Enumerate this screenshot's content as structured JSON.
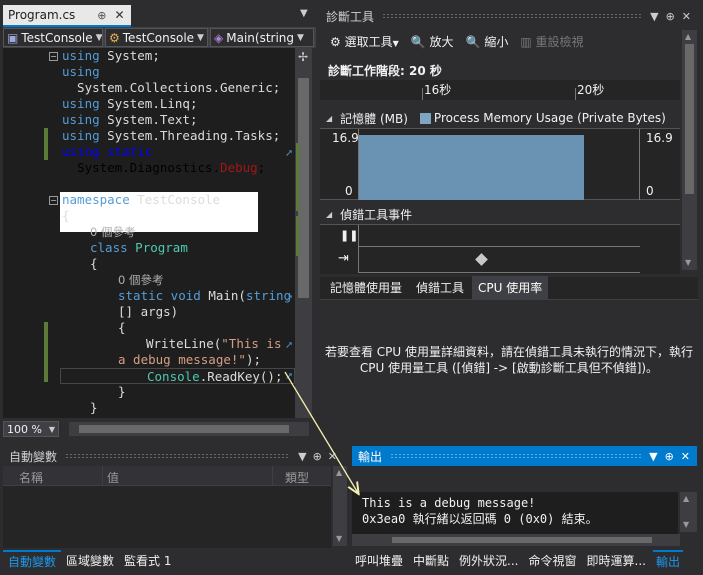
{
  "editor": {
    "tab_title": "Program.cs",
    "tab_pin": "⊕",
    "tab_close": "×",
    "nav": {
      "project": "TestConsole",
      "class": "TestConsole",
      "member": "Main(string"
    },
    "zoom": "100 %",
    "references_0": "0 個參考",
    "references_1": "0 個參考",
    "code": {
      "l1_kw": "using",
      "l1_tx": " System;",
      "l2_kw": "using",
      "l3_tx": "  System.Collections.Generic;",
      "l4_kw": "using",
      "l4_tx": " System.Linq;",
      "l5_kw": "using",
      "l5_tx": " System.Text;",
      "l6_kw": "using",
      "l6_tx": " System.Threading.Tasks;",
      "l7_kw": "using static",
      "l8_tx": "  System.Diagnostics.",
      "l8_ty": "Debug",
      "l8_end": ";",
      "l9_kw": "namespace",
      "l9_tx": " TestConsole",
      "l10_tx": "{",
      "l12_kw": "class",
      "l12_ty": " Program",
      "l13_tx": "{",
      "l15_kw": "static void",
      "l15_tx": " Main(",
      "l15_kw2": "string",
      "l16_tx": "[] args)",
      "l17_tx": "{",
      "l18_tx": "WriteLine(",
      "l18_st": "\"This is",
      "l19_st": "a debug message!\"",
      "l19_tx": ");",
      "l20_ty": "Console",
      "l20_tx": ".ReadKey();",
      "l21_tx": "}",
      "l22_tx": "}"
    }
  },
  "diagnostics": {
    "title": "診斷工具",
    "toolbar": {
      "select_tool": "選取工具",
      "zoom_in": "放大",
      "zoom_out": "縮小",
      "reset_view": "重設檢視"
    },
    "session": "診斷工作階段: 20 秒",
    "ruler": {
      "label_1": "16秒",
      "label_2": "20秒"
    },
    "memory": {
      "header": "記憶體 (MB)",
      "legend": "Process Memory Usage (Private Bytes)",
      "y_max_left": "16.9",
      "y_min_left": "0",
      "y_max_right": "16.9",
      "y_min_right": "0",
      "usage_fraction": 1.0
    },
    "events_header": "偵錯工具事件",
    "tabs": {
      "memory": "記憶體使用量",
      "debugger": "偵錯工具",
      "cpu": "CPU 使用率"
    },
    "cpu_message_1": "若要查看 CPU 使用量詳細資料，請在偵錯工具未執行的情況下，執行",
    "cpu_message_2": "CPU 使用量工具 ([偵錯] -> [啟動診斷工具但不偵錯])。"
  },
  "autos": {
    "title": "自動變數",
    "columns": {
      "name": "名稱",
      "value": "值",
      "type": "類型"
    },
    "tabs": {
      "autos": "自動變數",
      "locals": "區域變數",
      "watch": "監看式 1"
    }
  },
  "output": {
    "title": "輸出",
    "line1": "This is a debug message!",
    "line2": "0x3ea0 執行緒以返回碼 0 (0x0) 結束。",
    "tabs": {
      "call_stack": "呼叫堆疊",
      "breakpoints": "中斷點",
      "exceptions": "例外狀況...",
      "command": "命令視窗",
      "immediate": "即時運算...",
      "output": "輸出"
    }
  },
  "colors": {
    "accent": "#007acc",
    "memory_fill": "#6a93b3",
    "arrow": "#f5f0b0"
  }
}
